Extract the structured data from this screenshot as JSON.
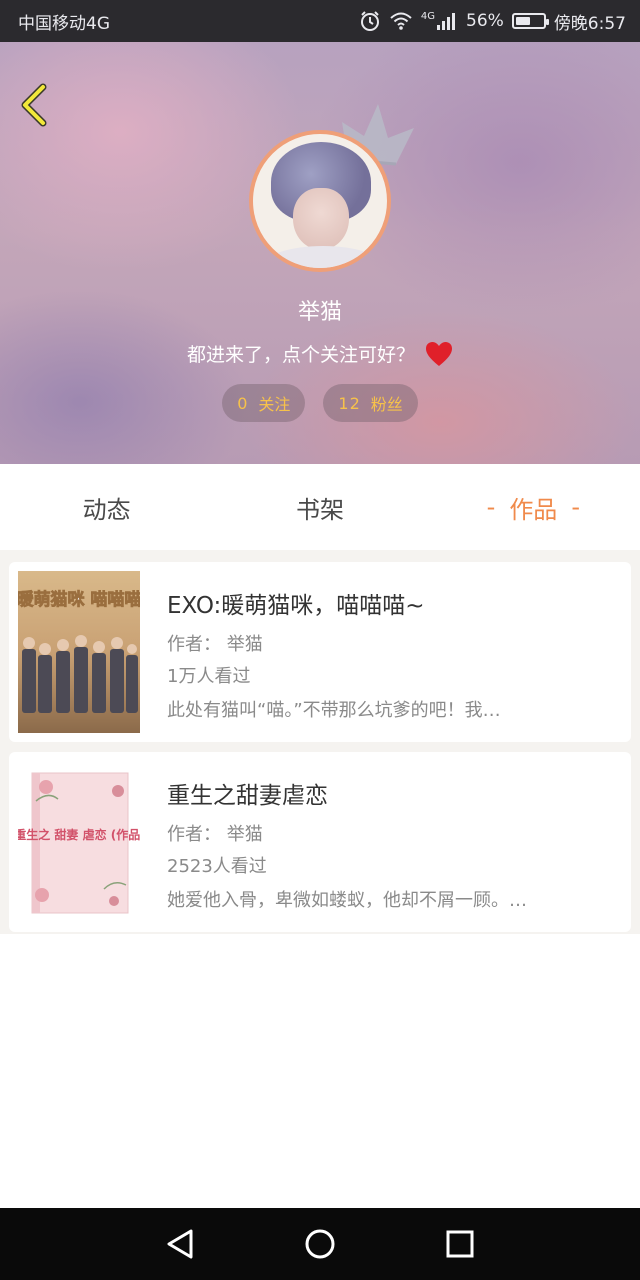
{
  "status_bar": {
    "carrier": "中国移动4G",
    "network_badge": "4G",
    "battery_percent": "56%",
    "battery_level": 0.56,
    "time": "傍晚6:57",
    "icons": [
      "alarm-icon",
      "wifi-icon",
      "signal-icon",
      "battery-icon"
    ]
  },
  "profile": {
    "back_icon": "chevron-left-icon",
    "nickname": "举猫",
    "signature": "都进来了，点个关注可好？",
    "signature_icon": "heart-icon",
    "following": {
      "count": "0",
      "label": "关注"
    },
    "followers": {
      "count": "12",
      "label": "粉丝"
    }
  },
  "tabs": [
    {
      "label": "动态",
      "active": false
    },
    {
      "label": "书架",
      "active": false
    },
    {
      "label": "作品",
      "active": true,
      "decor": "-"
    }
  ],
  "books": [
    {
      "title": "EXO:暖萌猫咪，喵喵喵~",
      "author_label": "作者：",
      "author": "举猫",
      "views": "1万人看过",
      "intro": "此处有猫叫“喵。”不带那么坑爹的吧！我…",
      "cover_text": "暖萌猫咪 喵喵喵"
    },
    {
      "title": "重生之甜妻虐恋",
      "author_label": "作者：",
      "author": "举猫",
      "views": "2523人看过",
      "intro": "她爱他入骨，卑微如蝼蚁，他却不屑一顾。…",
      "cover_text": "重生之 甜妻 虐恋 (作品)"
    }
  ],
  "colors": {
    "accent": "#f08a4b",
    "stat_text": "#f7c24a",
    "avatar_border": "#ef9f78",
    "heart": "#e0202a"
  },
  "nav_bar": {
    "icons": [
      "back-triangle-icon",
      "home-circle-icon",
      "recents-square-icon"
    ]
  }
}
